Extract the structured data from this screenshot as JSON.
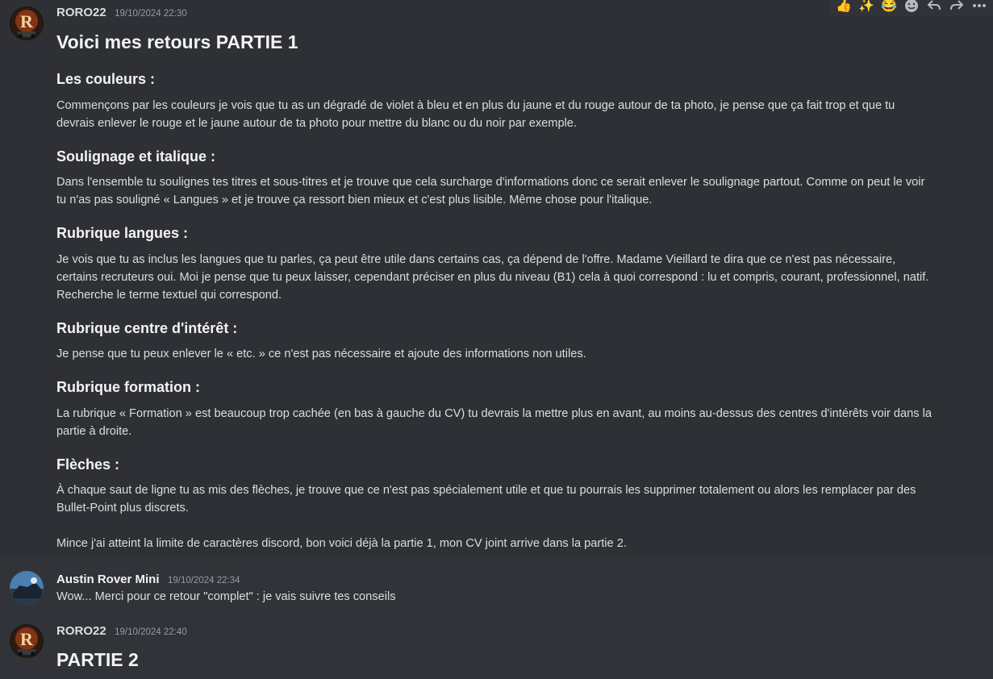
{
  "messages": [
    {
      "author": "RORO22",
      "timestamp": "19/10/2024 22:30",
      "title": "Voici mes retours PARTIE 1",
      "sections": [
        {
          "heading": "Les couleurs :",
          "lines": [
            "Commençons par les couleurs je vois que tu as un dégradé de violet à bleu et en plus du jaune et du rouge autour de ta photo, je pense que ça fait trop et que tu",
            "devrais enlever le rouge et le jaune autour de ta photo pour mettre du blanc ou du noir par exemple."
          ]
        },
        {
          "heading": "Soulignage et italique :",
          "lines": [
            "Dans l'ensemble tu soulignes tes titres et sous-titres et je trouve que cela surcharge d'informations donc ce serait enlever le soulignage partout. Comme on peut le voir",
            "tu n'as pas souligné « Langues » et je trouve ça ressort bien mieux et c'est plus lisible. Même chose pour l'italique."
          ]
        },
        {
          "heading": "Rubrique langues :",
          "lines": [
            "Je vois que tu as inclus les langues que tu parles, ça peut être utile dans certains cas, ça dépend de l'offre. Madame Vieillard te dira que ce n'est pas nécessaire,",
            "certains recruteurs oui. Moi je pense que tu peux laisser, cependant préciser en plus du niveau (B1) cela à quoi correspond : lu et compris, courant, professionnel, natif.",
            "Recherche le terme textuel qui correspond."
          ]
        },
        {
          "heading": "Rubrique centre d'intérêt :",
          "lines": [
            "Je pense que tu peux enlever le « etc. » ce n'est pas nécessaire et ajoute des informations non utiles."
          ]
        },
        {
          "heading": "Rubrique formation :",
          "lines": [
            "La rubrique « Formation » est beaucoup trop cachée (en bas à gauche du CV) tu devrais la mettre plus en avant, au moins au-dessus des centres d'intérêts voir dans la",
            "partie à droite."
          ]
        },
        {
          "heading": "Flèches :",
          "lines": [
            "À chaque saut de ligne tu as mis des flèches, je trouve que ce n'est pas spécialement utile et que tu pourrais les supprimer totalement ou alors les remplacer par des",
            "Bullet-Point plus discrets."
          ]
        }
      ],
      "closing": "Mince j'ai atteint la limite de caractères discord, bon voici déjà la partie 1, mon CV joint arrive dans la partie 2."
    },
    {
      "author": "Austin Rover Mini",
      "timestamp": "19/10/2024 22:34",
      "text": "Wow... Merci pour ce retour \"complet\" : je vais suivre tes conseils"
    },
    {
      "author": "RORO22",
      "timestamp": "19/10/2024 22:40",
      "title": "PARTIE 2"
    }
  ],
  "toolbar": {
    "reactions": [
      "👍",
      "✨",
      "😂"
    ],
    "actions": [
      "add-reaction",
      "reply",
      "forward",
      "more"
    ]
  },
  "colors": {
    "background": "#313338",
    "hover_background": "#2e3035",
    "text": "#dbdee1",
    "heading": "#f2f3f5",
    "timestamp": "#949ba4"
  }
}
